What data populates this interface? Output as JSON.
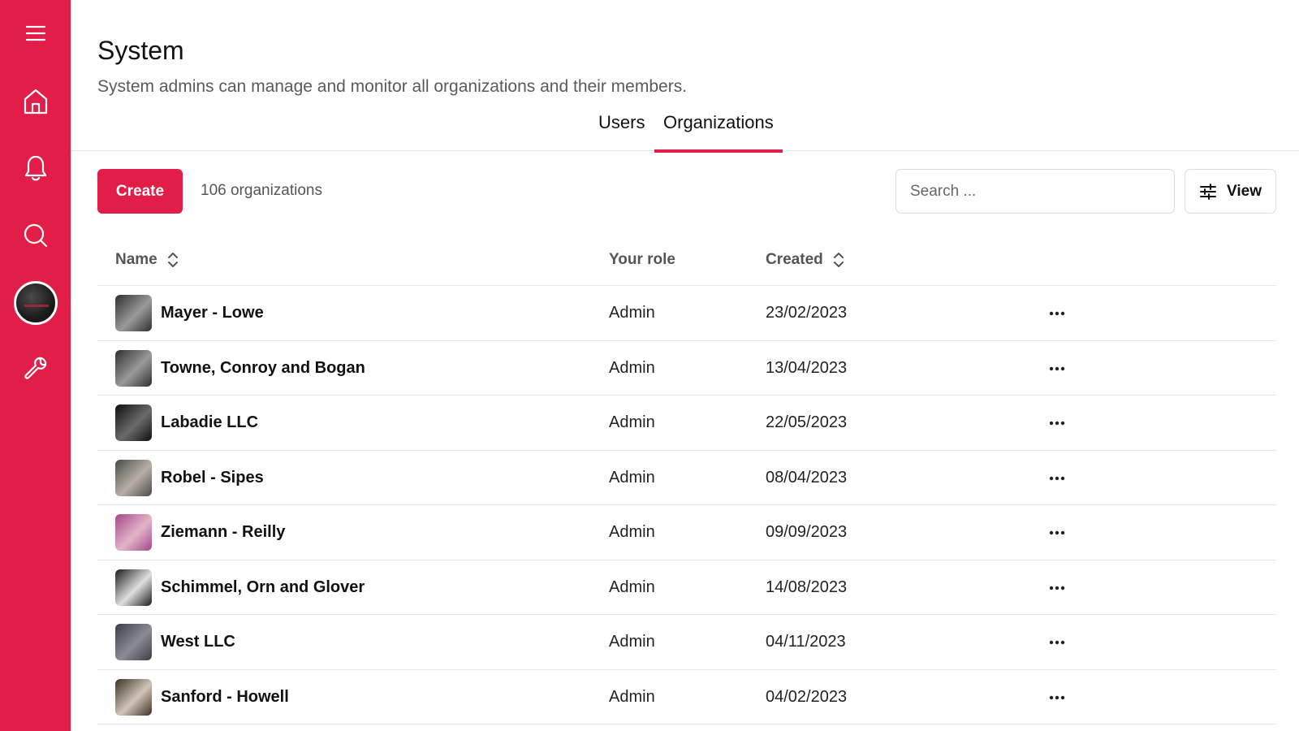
{
  "sidebar": {
    "items": [
      {
        "icon": "menu-icon"
      },
      {
        "icon": "home-icon"
      },
      {
        "icon": "bell-icon"
      },
      {
        "icon": "search-icon"
      },
      {
        "icon": "user-avatar"
      },
      {
        "icon": "wrench-icon"
      }
    ],
    "accent_color": "#e21d48"
  },
  "header": {
    "title": "System",
    "subtitle": "System admins can manage and monitor all organizations and their members."
  },
  "tabs": [
    {
      "label": "Users",
      "active": false
    },
    {
      "label": "Organizations",
      "active": true
    }
  ],
  "toolbar": {
    "create_label": "Create",
    "count_label": "106 organizations",
    "search_placeholder": "Search ...",
    "view_label": "View"
  },
  "table": {
    "columns": {
      "name": "Name",
      "role": "Your role",
      "created": "Created"
    },
    "rows": [
      {
        "name": "Mayer - Lowe",
        "role": "Admin",
        "created": "23/02/2023",
        "thumb": [
          "#2e2e2e",
          "#9a9a9a"
        ]
      },
      {
        "name": "Towne, Conroy and Bogan",
        "role": "Admin",
        "created": "13/04/2023",
        "thumb": [
          "#2e2e2e",
          "#9a9a9a"
        ]
      },
      {
        "name": "Labadie LLC",
        "role": "Admin",
        "created": "22/05/2023",
        "thumb": [
          "#0f0f0f",
          "#6b6b6b"
        ]
      },
      {
        "name": "Robel - Sipes",
        "role": "Admin",
        "created": "08/04/2023",
        "thumb": [
          "#4a4a4a",
          "#b8b0a4"
        ]
      },
      {
        "name": "Ziemann - Reilly",
        "role": "Admin",
        "created": "09/09/2023",
        "thumb": [
          "#a3468a",
          "#e3b5c8"
        ]
      },
      {
        "name": "Schimmel, Orn and Glover",
        "role": "Admin",
        "created": "14/08/2023",
        "thumb": [
          "#1a1a1a",
          "#e0e0e0"
        ]
      },
      {
        "name": "West LLC",
        "role": "Admin",
        "created": "04/11/2023",
        "thumb": [
          "#3c3c46",
          "#8c8c96"
        ]
      },
      {
        "name": "Sanford - Howell",
        "role": "Admin",
        "created": "04/02/2023",
        "thumb": [
          "#3a3026",
          "#cfc6b8"
        ]
      }
    ]
  }
}
